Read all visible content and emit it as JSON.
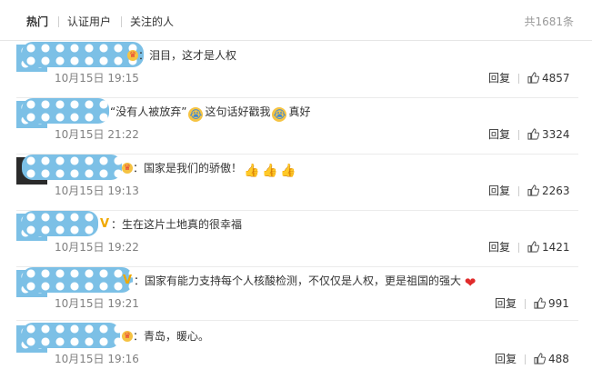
{
  "tabs": {
    "hot": "热门",
    "verified": "认证用户",
    "following": "关注的人",
    "total": "共1681条"
  },
  "comments": [
    {
      "text_before": "：泪目，这才是人权",
      "badge": "crown-icon",
      "time": "10月15日 19:15",
      "reply": "回复",
      "likes": "4857"
    },
    {
      "text_before": "“没有人被放弃”",
      "text_middle": "这句话好戳我",
      "text_after": "真好",
      "time": "10月15日 21:22",
      "reply": "回复",
      "likes": "3324"
    },
    {
      "text_before": "：国家是我们的骄傲！",
      "badge": "crown-icon",
      "time": "10月15日 19:13",
      "reply": "回复",
      "likes": "2263"
    },
    {
      "text_before": "：生在这片土地真的很幸福",
      "badge": "verified-v-icon",
      "time": "10月15日 19:22",
      "reply": "回复",
      "likes": "1421"
    },
    {
      "text_before": "：国家有能力支持每个人核酸检测，不仅仅是人权，更是祖国的强大",
      "badge": "verified-v-icon",
      "time": "10月15日 19:21",
      "reply": "回复",
      "likes": "991"
    },
    {
      "text_before": "：青岛，暖心。",
      "badge": "crown-icon",
      "time": "10月15日 19:16",
      "reply": "回复",
      "likes": "488"
    }
  ]
}
